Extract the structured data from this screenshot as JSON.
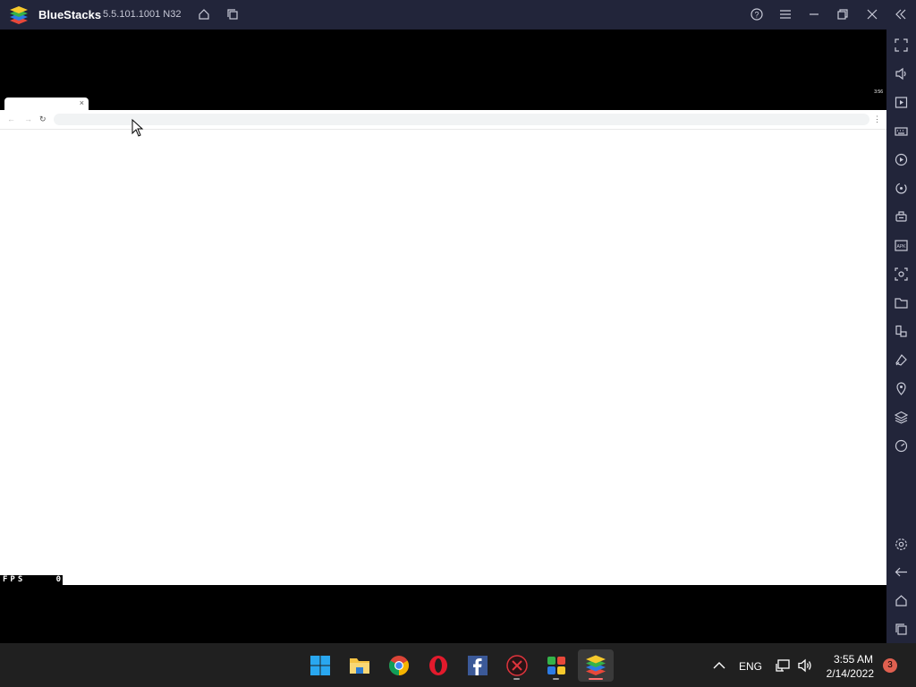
{
  "titlebar": {
    "app_name": "BlueStacks",
    "version": "5.5.101.1001 N32"
  },
  "android": {
    "status_clock": "3:56",
    "browser": {
      "tab_close": "×",
      "omnibox_value": "",
      "omnibox_placeholder": ""
    },
    "fps_label": "FPS",
    "fps_value": "0"
  },
  "sidebar_icons": [
    "fullscreen-icon",
    "volume-icon",
    "media-manager-icon",
    "keyboard-icon",
    "macro-recorder-icon",
    "sync-icon",
    "game-controls-icon",
    "apk-install-icon",
    "screenshot-icon",
    "folder-icon",
    "multi-instance-icon",
    "eco-mode-icon",
    "location-icon",
    "layers-icon",
    "performance-icon",
    "settings-icon",
    "back-icon",
    "home-icon",
    "recent-apps-icon"
  ],
  "taskbar": {
    "apps": [
      "windows-start-icon",
      "file-explorer-icon",
      "chrome-icon",
      "opera-icon",
      "facebook-icon",
      "bluestacks-x-icon",
      "multi-instance-manager-icon",
      "bluestacks-icon"
    ],
    "language": "ENG",
    "time": "3:55 AM",
    "date": "2/14/2022",
    "notification_count": "3"
  },
  "colors": {
    "titlebar": "#22253a",
    "taskbar": "#202020",
    "accent": "#ff6f6f"
  }
}
